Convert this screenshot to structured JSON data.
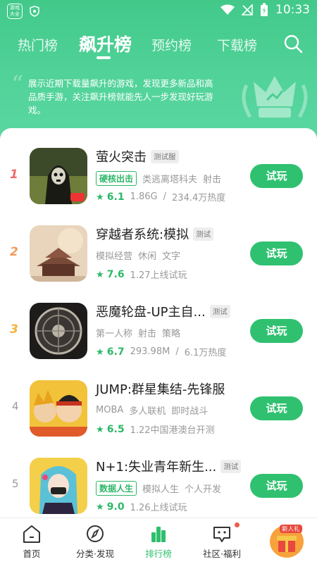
{
  "status_bar": {
    "time": "10:33",
    "app_logo_text": "游戏大全"
  },
  "tabs": [
    {
      "label": "热门榜",
      "active": false
    },
    {
      "label": "飙升榜",
      "active": true
    },
    {
      "label": "预约榜",
      "active": false
    },
    {
      "label": "下载榜",
      "active": false
    }
  ],
  "header": {
    "description": "展示近期下载量飙升的游戏，发现更多新品和高品质手游，关注飙升榜就能先人一步发现好玩游戏。"
  },
  "games": [
    {
      "rank": "1",
      "title": "萤火突击",
      "badge": "测试服",
      "tag_highlight": "硬核出击",
      "tags": [
        "类逃离塔科夫",
        "射击"
      ],
      "score": "6.1",
      "size": "1.86G",
      "extra": "234.4万热度",
      "button": "试玩"
    },
    {
      "rank": "2",
      "title": "穿越者系统:模拟",
      "badge": "测试",
      "tag_highlight": "",
      "tags": [
        "模拟经营",
        "休闲",
        "文字"
      ],
      "score": "7.6",
      "size": "",
      "extra": "1.27上线试玩",
      "button": "试玩"
    },
    {
      "rank": "3",
      "title": "恶魔轮盘-UP主自...",
      "badge": "测试",
      "tag_highlight": "",
      "tags": [
        "第一人称",
        "射击",
        "策略"
      ],
      "score": "6.7",
      "size": "293.98M",
      "extra": "6.1万热度",
      "button": "试玩"
    },
    {
      "rank": "4",
      "title": "JUMP:群星集结-先锋服",
      "badge": "",
      "tag_highlight": "",
      "tags": [
        "MOBA",
        "多人联机",
        "即时战斗"
      ],
      "score": "6.5",
      "size": "",
      "extra": "1.22中国港澳台开测",
      "button": "试玩"
    },
    {
      "rank": "5",
      "title": "N+1:失业青年新生...",
      "badge": "测试",
      "tag_highlight": "数据人生",
      "tags": [
        "模拟人生",
        "个人开发"
      ],
      "score": "9.0",
      "size": "",
      "extra": "1.26上线试玩",
      "button": "试玩"
    }
  ],
  "bottom_nav": [
    {
      "label": "首页",
      "icon": "home-icon"
    },
    {
      "label": "分类·发现",
      "icon": "compass-icon"
    },
    {
      "label": "排行榜",
      "icon": "ranking-icon",
      "active": true
    },
    {
      "label": "社区·福利",
      "icon": "community-icon"
    }
  ],
  "gift": {
    "badge": "新人礼"
  },
  "colors": {
    "accent": "#2fc170",
    "header": "#4cce93"
  }
}
